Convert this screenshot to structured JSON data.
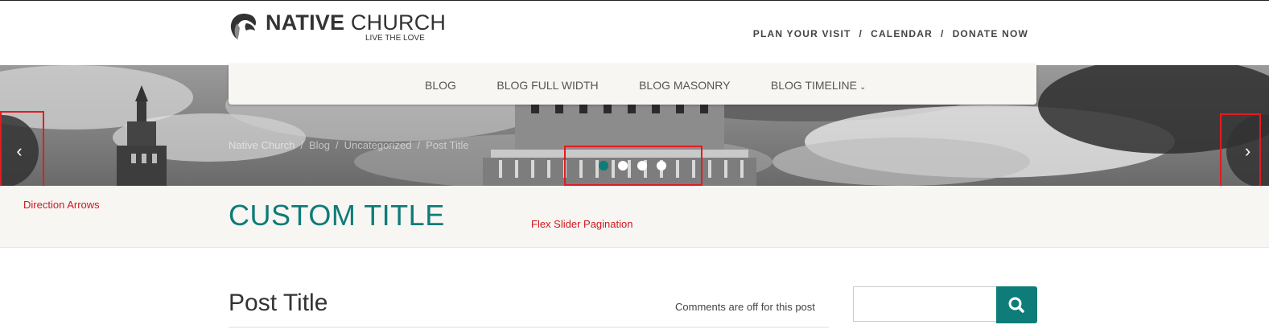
{
  "header": {
    "logo": {
      "name_bold": "NATIVE",
      "name_light": "CHURCH",
      "tagline": "LIVE THE LOVE"
    },
    "top_links": [
      "PLAN YOUR VISIT",
      "CALENDAR",
      "DONATE NOW"
    ],
    "separator": "/"
  },
  "main_nav": {
    "items": [
      {
        "label": "BLOG"
      },
      {
        "label": "BLOG FULL WIDTH"
      },
      {
        "label": "BLOG MASONRY"
      },
      {
        "label": "BLOG TIMELINE",
        "has_dropdown": true
      }
    ]
  },
  "breadcrumb": {
    "items": [
      "Native Church",
      "Blog",
      "Uncategorized",
      "Post Title"
    ],
    "separator": "/"
  },
  "slider": {
    "pagination": {
      "count": 4,
      "active_index": 0
    },
    "prev_arrow": "‹",
    "next_arrow": "›"
  },
  "annotations": {
    "direction_arrows": "Direction Arrows",
    "pagination": "Flex Slider Pagination"
  },
  "page": {
    "title": "CUSTOM TITLE"
  },
  "post": {
    "title": "Post Title",
    "comments": "Comments are off for this post"
  },
  "search": {
    "value": "",
    "placeholder": ""
  },
  "colors": {
    "accent": "#0e7c78",
    "annotation": "#e21b22",
    "title_bar": "#f7f6f3"
  },
  "icons": {
    "search": "search-icon",
    "chevron": "chevron-down-icon",
    "logo": "church-logo-icon"
  }
}
